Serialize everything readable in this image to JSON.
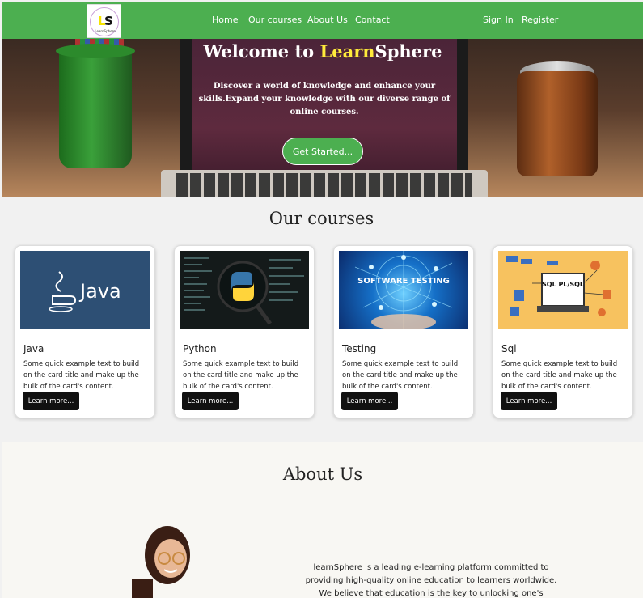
{
  "navbar": {
    "logo_text": "LearnSphere",
    "links": [
      "Home",
      "Our courses",
      "About Us",
      "Contact"
    ],
    "auth": [
      "Sign In",
      "Register"
    ]
  },
  "hero": {
    "title_prefix": "Welcome to ",
    "title_accent": "Learn",
    "title_suffix": "Sphere",
    "subtitle": "Discover a world of knowledge and enhance your skills.Expand your knowledge with our diverse range of online courses.",
    "cta": "Get Started..."
  },
  "courses": {
    "heading": "Our courses",
    "items": [
      {
        "title": "Java",
        "text": "Some quick example text to build on the card title and make up the bulk of the card's content.",
        "button": "Learn more..."
      },
      {
        "title": "Python",
        "text": "Some quick example text to build on the card title and make up the bulk of the card's content.",
        "button": "Learn more..."
      },
      {
        "title": "Testing",
        "text": "Some quick example text to build on the card title and make up the bulk of the card's content.",
        "button": "Learn more..."
      },
      {
        "title": "Sql",
        "text": "Some quick example text to build on the card title and make up the bulk of the card's content.",
        "button": "Learn more..."
      }
    ],
    "image_labels": {
      "java": "Java",
      "testing": "SOFTWARE TESTING",
      "sql": "SQL PL/SQL"
    }
  },
  "about": {
    "heading": "About Us",
    "text": "learnSphere is a leading e-learning platform committed to providing high-quality online education to learners worldwide. We believe that education is the key to unlocking one's potential and"
  },
  "colors": {
    "brand_green": "#4caf50",
    "accent_yellow": "#ffeb3b",
    "button_dark": "#111111"
  }
}
